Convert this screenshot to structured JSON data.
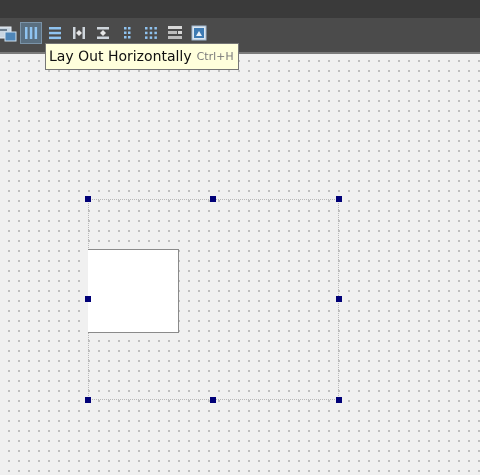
{
  "tooltip": {
    "label": "Lay Out Horizontally",
    "shortcut": "Ctrl+H"
  },
  "toolbar": {
    "buttons": [
      {
        "name": "edit-buddies-icon",
        "active": false
      },
      {
        "name": "layout-horizontal-icon",
        "active": true
      },
      {
        "name": "layout-vertical-icon",
        "active": false
      },
      {
        "name": "layout-horizontal-splitter-icon",
        "active": false
      },
      {
        "name": "layout-vertical-splitter-icon",
        "active": false
      },
      {
        "name": "layout-form-icon",
        "active": false
      },
      {
        "name": "layout-grid-icon",
        "active": false
      },
      {
        "name": "break-layout-icon",
        "active": false
      },
      {
        "name": "adjust-size-icon",
        "active": false
      }
    ]
  },
  "colors": {
    "toolbar": "#4b4b4b",
    "titlebar": "#3a3a3a",
    "canvas": "#f0f0f0",
    "grid_dot": "#7d7d7d",
    "tooltip_bg": "#ffffdc",
    "selection_handle": "#000077",
    "icon_blue": "#6fa8dc"
  }
}
